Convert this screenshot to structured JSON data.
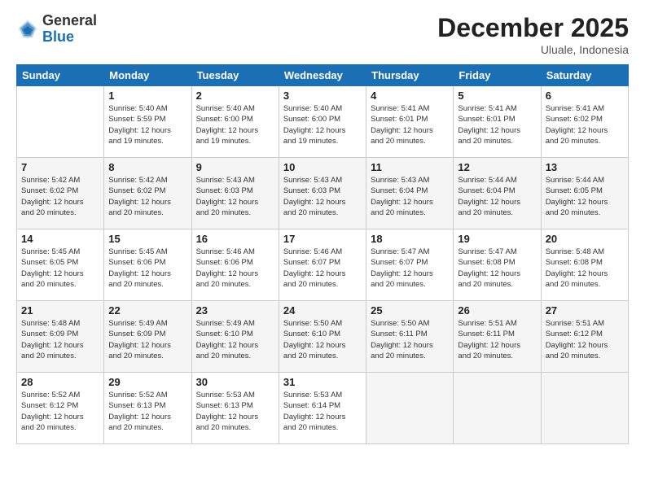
{
  "logo": {
    "general": "General",
    "blue": "Blue"
  },
  "header": {
    "month_year": "December 2025",
    "location": "Uluale, Indonesia"
  },
  "weekdays": [
    "Sunday",
    "Monday",
    "Tuesday",
    "Wednesday",
    "Thursday",
    "Friday",
    "Saturday"
  ],
  "weeks": [
    [
      {
        "day": "",
        "info": ""
      },
      {
        "day": "1",
        "info": "Sunrise: 5:40 AM\nSunset: 5:59 PM\nDaylight: 12 hours\nand 19 minutes."
      },
      {
        "day": "2",
        "info": "Sunrise: 5:40 AM\nSunset: 6:00 PM\nDaylight: 12 hours\nand 19 minutes."
      },
      {
        "day": "3",
        "info": "Sunrise: 5:40 AM\nSunset: 6:00 PM\nDaylight: 12 hours\nand 19 minutes."
      },
      {
        "day": "4",
        "info": "Sunrise: 5:41 AM\nSunset: 6:01 PM\nDaylight: 12 hours\nand 20 minutes."
      },
      {
        "day": "5",
        "info": "Sunrise: 5:41 AM\nSunset: 6:01 PM\nDaylight: 12 hours\nand 20 minutes."
      },
      {
        "day": "6",
        "info": "Sunrise: 5:41 AM\nSunset: 6:02 PM\nDaylight: 12 hours\nand 20 minutes."
      }
    ],
    [
      {
        "day": "7",
        "info": "Sunrise: 5:42 AM\nSunset: 6:02 PM\nDaylight: 12 hours\nand 20 minutes."
      },
      {
        "day": "8",
        "info": "Sunrise: 5:42 AM\nSunset: 6:02 PM\nDaylight: 12 hours\nand 20 minutes."
      },
      {
        "day": "9",
        "info": "Sunrise: 5:43 AM\nSunset: 6:03 PM\nDaylight: 12 hours\nand 20 minutes."
      },
      {
        "day": "10",
        "info": "Sunrise: 5:43 AM\nSunset: 6:03 PM\nDaylight: 12 hours\nand 20 minutes."
      },
      {
        "day": "11",
        "info": "Sunrise: 5:43 AM\nSunset: 6:04 PM\nDaylight: 12 hours\nand 20 minutes."
      },
      {
        "day": "12",
        "info": "Sunrise: 5:44 AM\nSunset: 6:04 PM\nDaylight: 12 hours\nand 20 minutes."
      },
      {
        "day": "13",
        "info": "Sunrise: 5:44 AM\nSunset: 6:05 PM\nDaylight: 12 hours\nand 20 minutes."
      }
    ],
    [
      {
        "day": "14",
        "info": "Sunrise: 5:45 AM\nSunset: 6:05 PM\nDaylight: 12 hours\nand 20 minutes."
      },
      {
        "day": "15",
        "info": "Sunrise: 5:45 AM\nSunset: 6:06 PM\nDaylight: 12 hours\nand 20 minutes."
      },
      {
        "day": "16",
        "info": "Sunrise: 5:46 AM\nSunset: 6:06 PM\nDaylight: 12 hours\nand 20 minutes."
      },
      {
        "day": "17",
        "info": "Sunrise: 5:46 AM\nSunset: 6:07 PM\nDaylight: 12 hours\nand 20 minutes."
      },
      {
        "day": "18",
        "info": "Sunrise: 5:47 AM\nSunset: 6:07 PM\nDaylight: 12 hours\nand 20 minutes."
      },
      {
        "day": "19",
        "info": "Sunrise: 5:47 AM\nSunset: 6:08 PM\nDaylight: 12 hours\nand 20 minutes."
      },
      {
        "day": "20",
        "info": "Sunrise: 5:48 AM\nSunset: 6:08 PM\nDaylight: 12 hours\nand 20 minutes."
      }
    ],
    [
      {
        "day": "21",
        "info": "Sunrise: 5:48 AM\nSunset: 6:09 PM\nDaylight: 12 hours\nand 20 minutes."
      },
      {
        "day": "22",
        "info": "Sunrise: 5:49 AM\nSunset: 6:09 PM\nDaylight: 12 hours\nand 20 minutes."
      },
      {
        "day": "23",
        "info": "Sunrise: 5:49 AM\nSunset: 6:10 PM\nDaylight: 12 hours\nand 20 minutes."
      },
      {
        "day": "24",
        "info": "Sunrise: 5:50 AM\nSunset: 6:10 PM\nDaylight: 12 hours\nand 20 minutes."
      },
      {
        "day": "25",
        "info": "Sunrise: 5:50 AM\nSunset: 6:11 PM\nDaylight: 12 hours\nand 20 minutes."
      },
      {
        "day": "26",
        "info": "Sunrise: 5:51 AM\nSunset: 6:11 PM\nDaylight: 12 hours\nand 20 minutes."
      },
      {
        "day": "27",
        "info": "Sunrise: 5:51 AM\nSunset: 6:12 PM\nDaylight: 12 hours\nand 20 minutes."
      }
    ],
    [
      {
        "day": "28",
        "info": "Sunrise: 5:52 AM\nSunset: 6:12 PM\nDaylight: 12 hours\nand 20 minutes."
      },
      {
        "day": "29",
        "info": "Sunrise: 5:52 AM\nSunset: 6:13 PM\nDaylight: 12 hours\nand 20 minutes."
      },
      {
        "day": "30",
        "info": "Sunrise: 5:53 AM\nSunset: 6:13 PM\nDaylight: 12 hours\nand 20 minutes."
      },
      {
        "day": "31",
        "info": "Sunrise: 5:53 AM\nSunset: 6:14 PM\nDaylight: 12 hours\nand 20 minutes."
      },
      {
        "day": "",
        "info": ""
      },
      {
        "day": "",
        "info": ""
      },
      {
        "day": "",
        "info": ""
      }
    ]
  ]
}
